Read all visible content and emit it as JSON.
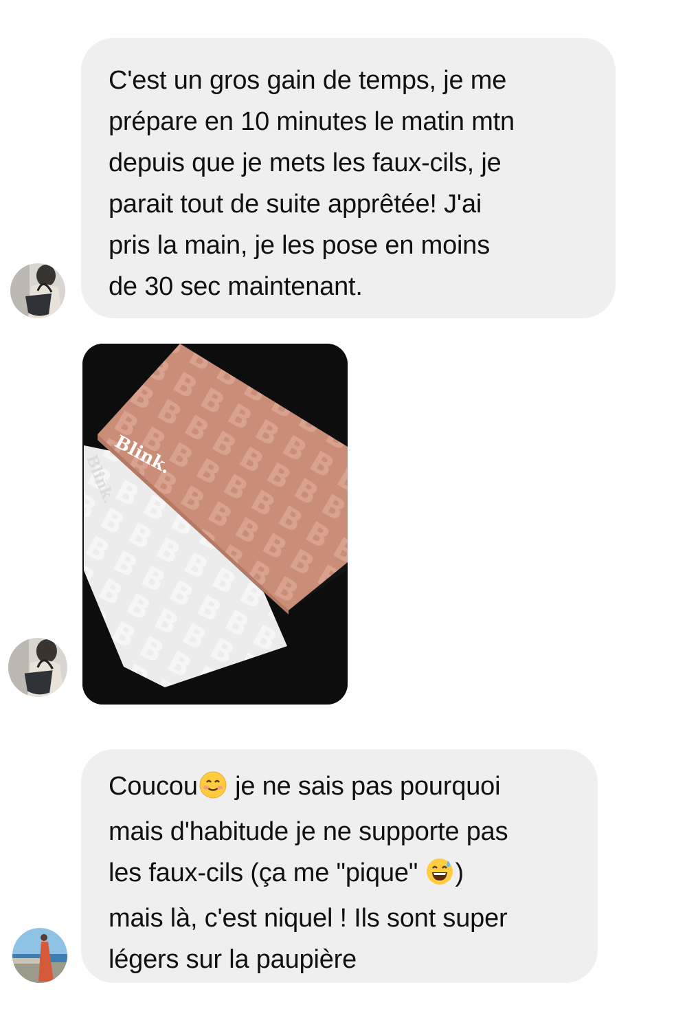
{
  "messages": [
    {
      "type": "text",
      "sender": "user-1",
      "lines": [
        "C'est un gros gain de temps, je me",
        "prépare en 10 minutes le matin mtn",
        "depuis que je mets les faux-cils, je",
        "parait tout de suite apprêtée! J'ai",
        "pris la main, je les pose en moins",
        "de 30 sec maintenant."
      ]
    },
    {
      "type": "image",
      "sender": "user-1",
      "brand_text": "Blink.",
      "brand_text_2": "Blink."
    },
    {
      "type": "text",
      "sender": "user-2",
      "lines": [
        "je ne sais pas pourquoi",
        "mais d'habitude je ne supporte pas",
        "les faux-cils (ça me \"pique\"",
        "mais là, c'est niquel ! Ils sont super",
        "légers sur la paupière"
      ],
      "first_word": "Coucou",
      "emoji_1": "smiling-face-emoji",
      "emoji_2": "grinning-sweat-emoji",
      "closing_paren": ")"
    }
  ],
  "colors": {
    "bubble_bg": "#efefef",
    "page_bg": "#ffffff",
    "text": "#111111",
    "product_pink": "#c98d78",
    "product_white": "#ececec"
  }
}
